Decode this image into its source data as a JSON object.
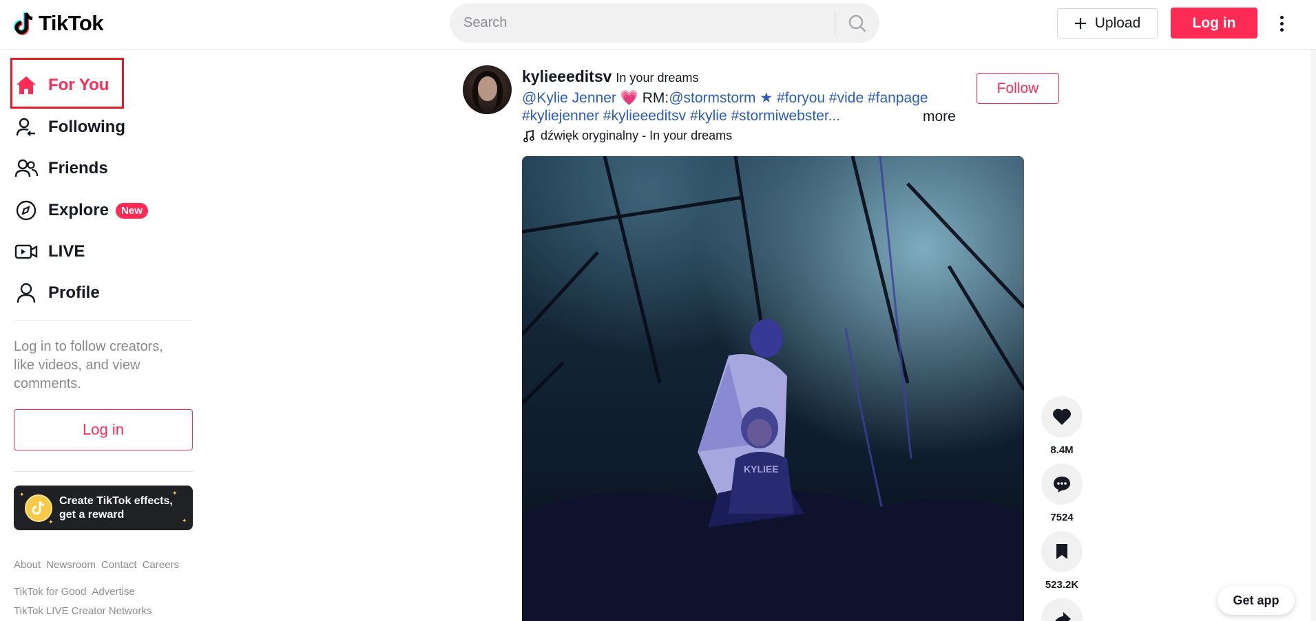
{
  "header": {
    "logo_text": "TikTok",
    "search_placeholder": "Search",
    "upload_label": "Upload",
    "login_label": "Log in"
  },
  "sidebar": {
    "nav": [
      {
        "label": "For You",
        "icon": "home-icon",
        "active": true
      },
      {
        "label": "Following",
        "icon": "following-icon"
      },
      {
        "label": "Friends",
        "icon": "friends-icon"
      },
      {
        "label": "Explore",
        "icon": "explore-icon",
        "badge": "New"
      },
      {
        "label": "LIVE",
        "icon": "live-icon"
      },
      {
        "label": "Profile",
        "icon": "profile-icon"
      }
    ],
    "login_hint": "Log in to follow creators, like videos, and view comments.",
    "login_label": "Log in",
    "effects_line1": "Create TikTok effects,",
    "effects_line2": "get a reward",
    "footer": {
      "row1": [
        "About",
        "Newsroom",
        "Contact",
        "Careers"
      ],
      "row2": [
        "TikTok for Good",
        "Advertise"
      ],
      "row3": [
        "TikTok LIVE Creator Networks"
      ]
    }
  },
  "post": {
    "author_name": "kylieeeditsv",
    "author_nick": "In your dreams",
    "follow_label": "Follow",
    "desc_mention1": "@Kylie Jenner",
    "desc_text1": " RM:",
    "desc_mention2": "@stormstorm",
    "desc_star": " ★ ",
    "desc_tags_line1": "#foryou #vide #fanpage",
    "desc_tags_line2": "#kyliejenner #kylieeeditsv #kylie #stormiwebster...",
    "more_label": "more",
    "music": "dźwięk oryginalny - In your dreams",
    "video_watermark": "KYLIEE",
    "likes": "8.4M",
    "comments": "7524",
    "saves": "523.2K"
  },
  "get_app_label": "Get app",
  "colors": {
    "accent": "#fe2c55",
    "tag_link": "#2b5db9",
    "highlight_box": "#e31b23"
  }
}
